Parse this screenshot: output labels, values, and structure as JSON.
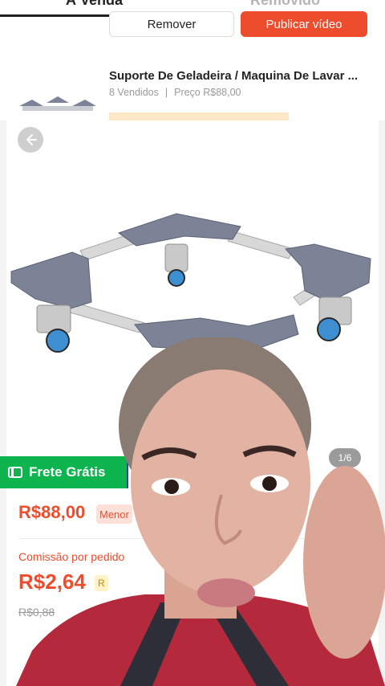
{
  "tabs": {
    "active": "À Venda",
    "inactive": "Removido"
  },
  "actions": {
    "remove": "Remover",
    "publish": "Publicar vídeo"
  },
  "product_row": {
    "title": "Suporte De Geladeira / Maquina De Lavar ...",
    "sold": "8 Vendidos",
    "price_label": "Preço R$88,00"
  },
  "card": {
    "image_counter": "1/6",
    "shipping_badge": "Frete Grátis",
    "price": "R$88,00",
    "price_tag": "Menor",
    "commission_label": "Comissão por pedido",
    "commission_value": "R$2,64",
    "commission_badge": "R",
    "old_price": "R$0,88"
  },
  "colors": {
    "brand": "#ee4d2d",
    "shipping": "#0eb44e"
  },
  "icons": {
    "back": "arrow-left-icon",
    "shipping": "truck-icon"
  }
}
